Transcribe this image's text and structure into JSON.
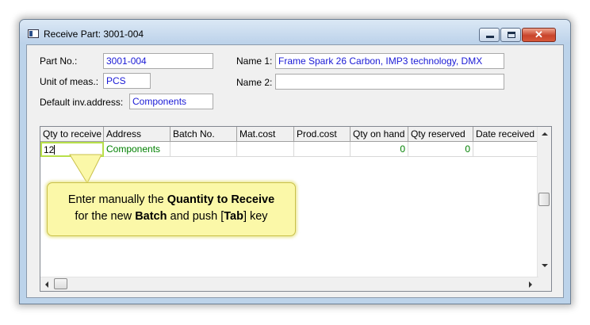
{
  "window": {
    "title": "Receive Part: 3001-004",
    "icons": {
      "app": "app-window-icon",
      "minimize": "minimize-icon",
      "maximize": "maximize-icon",
      "close": "close-icon"
    },
    "close_glyph": "✕"
  },
  "form": {
    "part_no": {
      "label": "Part No.:",
      "value": "3001-004"
    },
    "unit": {
      "label": "Unit of meas.:",
      "value": "PCS"
    },
    "default_address": {
      "label": "Default inv.address:",
      "value": "Components"
    },
    "name1": {
      "label": "Name 1:",
      "value": "Frame Spark 26 Carbon, IMP3 technology, DMX"
    },
    "name2": {
      "label": "Name 2:",
      "value": ""
    }
  },
  "grid": {
    "columns": [
      "Qty to receive",
      "Address",
      "Batch No.",
      "Mat.cost",
      "Prod.cost",
      "Qty on hand",
      "Qty reserved",
      "Date received"
    ],
    "rows": [
      {
        "qty_to_receive": "12",
        "address": "Components",
        "batch_no": "",
        "mat_cost": "",
        "prod_cost": "",
        "qty_on_hand": "0",
        "qty_reserved": "0",
        "date_received": ""
      }
    ]
  },
  "callout": {
    "part1": "Enter manually the ",
    "bold1": "Quantity to Receive",
    "part2": "for the new ",
    "bold2": "Batch",
    "part3": " and push [",
    "bold3": "Tab",
    "part4": "] key"
  },
  "colors": {
    "field_text": "#1a1ad6",
    "grid_value_text": "#008000",
    "callout_bg": "#fbf8a8",
    "highlight_border": "#b8e04a"
  }
}
